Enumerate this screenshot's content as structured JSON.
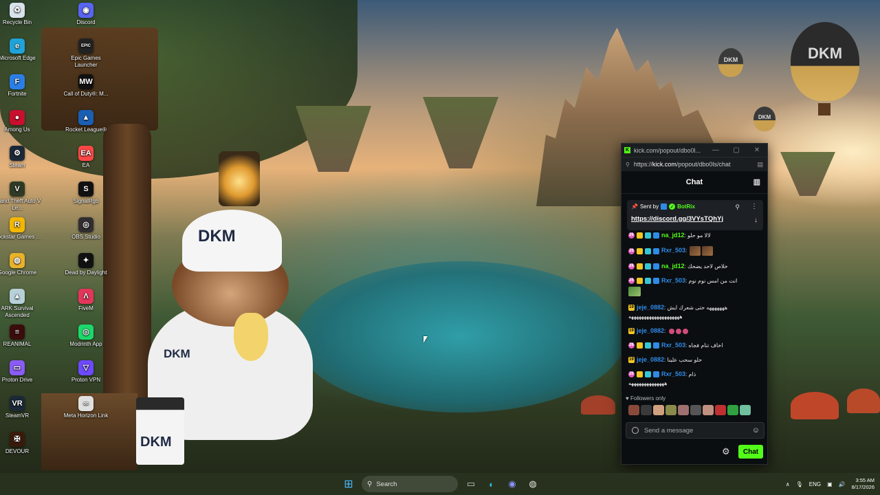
{
  "desktop_icons": [
    {
      "label": "Recycle Bin",
      "icon": "recycle-bin-icon",
      "color": "#d8e2ea",
      "glyph": "♻"
    },
    {
      "label": "Discord",
      "icon": "discord-icon",
      "color": "#5865f2",
      "glyph": "◉"
    },
    {
      "label": "Microsoft Edge",
      "icon": "edge-icon",
      "color": "#1fa3d8",
      "glyph": "e"
    },
    {
      "label": "Epic Games Launcher",
      "icon": "epic-games-icon",
      "color": "#222222",
      "glyph": "EPIC"
    },
    {
      "label": "Fortnite",
      "icon": "fortnite-icon",
      "color": "#2a7ee6",
      "glyph": "F"
    },
    {
      "label": "Call of Duty®: M...",
      "icon": "call-of-duty-icon",
      "color": "#111111",
      "glyph": "MW"
    },
    {
      "label": "Among Us",
      "icon": "among-us-icon",
      "color": "#c8102e",
      "glyph": "●"
    },
    {
      "label": "Rocket League®",
      "icon": "rocket-league-icon",
      "color": "#1a5fb4",
      "glyph": "▲"
    },
    {
      "label": "Steam",
      "icon": "steam-icon",
      "color": "#1b2838",
      "glyph": "⚙"
    },
    {
      "label": "EA",
      "icon": "ea-icon",
      "color": "#ff4747",
      "glyph": "EA"
    },
    {
      "label": "Grand Theft Auto V Le...",
      "icon": "gta-icon",
      "color": "#2e3a24",
      "glyph": "V"
    },
    {
      "label": "SignalRgb",
      "icon": "signalrgb-icon",
      "color": "#111111",
      "glyph": "S"
    },
    {
      "label": "Rockstar Games ...",
      "icon": "rockstar-icon",
      "color": "#f2b800",
      "glyph": "R"
    },
    {
      "label": "OBS Studio",
      "icon": "obs-icon",
      "color": "#302e31",
      "glyph": "◎"
    },
    {
      "label": "Google Chrome",
      "icon": "chrome-icon",
      "color": "#e8b22a",
      "glyph": "◍"
    },
    {
      "label": "Dead by Daylight",
      "icon": "dead-by-daylight-icon",
      "color": "#111111",
      "glyph": "✦"
    },
    {
      "label": "ARK Survival Ascended",
      "icon": "ark-icon",
      "color": "#b8d0d8",
      "glyph": "▲"
    },
    {
      "label": "FiveM",
      "icon": "fivem-icon",
      "color": "#e2365b",
      "glyph": "Λ"
    },
    {
      "label": "REANIMAL",
      "icon": "reanimal-icon",
      "color": "#3a0c0c",
      "glyph": "≡"
    },
    {
      "label": "Modrinth App",
      "icon": "modrinth-icon",
      "color": "#1bd96a",
      "glyph": "◎"
    },
    {
      "label": "Proton Drive",
      "icon": "proton-drive-icon",
      "color": "#8a5cf5",
      "glyph": "▭"
    },
    {
      "label": "Proton VPN",
      "icon": "proton-vpn-icon",
      "color": "#6d4aff",
      "glyph": "▽"
    },
    {
      "label": "SteamVR",
      "icon": "steamvr-icon",
      "color": "#1b2838",
      "glyph": "VR"
    },
    {
      "label": "Meta Horizon Link",
      "icon": "meta-horizon-icon",
      "color": "#e0e0e0",
      "glyph": "∞"
    },
    {
      "label": "DEVOUR",
      "icon": "devour-icon",
      "color": "#3a1a0a",
      "glyph": "✠"
    }
  ],
  "wallpaper": {
    "balloon_big": "DKM",
    "balloon_small_1": "DKM",
    "balloon_small_2": "DKM",
    "cap": "DKM",
    "shirt": "DKM",
    "cup": "DKM"
  },
  "kick_window": {
    "title": "kick.com/popout/dbo0l...",
    "url_prefix": "https://",
    "url_host": "kick.com",
    "url_path": "/popout/dbo0ls/chat",
    "chat_header": "Chat",
    "pinned": {
      "sent_by_label": "Sent by",
      "sender": "BotRix",
      "link": "https://discord.gg/3VYsTQhYj"
    },
    "messages": [
      {
        "user": "na_jd12",
        "user_color": "#53fc18",
        "text": "لالا مو حلو",
        "badges": [
          "sub",
          "crown",
          "vip",
          "og"
        ]
      },
      {
        "user": "Rxr_503",
        "user_color": "#2e8be8",
        "text": "",
        "badges": [
          "sub",
          "crown",
          "vip",
          "og"
        ],
        "emotes": 2
      },
      {
        "user": "na_jd12",
        "user_color": "#53fc18",
        "text": "خلاص لاحد يضحك",
        "badges": [
          "sub",
          "crown",
          "vip",
          "og"
        ]
      },
      {
        "user": "Rxr_503",
        "user_color": "#2e8be8",
        "text": "انت من امس نوم نوم",
        "badges": [
          "sub",
          "crown",
          "vip",
          "og"
        ]
      },
      {
        "user": "jeje_0882",
        "user_color": "#2e8be8",
        "text": "هههههههه حتى شعرك ايش",
        "badges": [
          "19"
        ]
      },
      {
        "user": "jeje_0882",
        "user_color": "#2e8be8",
        "text": "",
        "badges": [
          "19"
        ],
        "dots": 3
      },
      {
        "user": "Rxr_503",
        "user_color": "#2e8be8",
        "text": "اخاف تنام فجاه",
        "badges": [
          "sub",
          "crown",
          "vip",
          "og"
        ]
      },
      {
        "user": "jeje_0882",
        "user_color": "#2e8be8",
        "text": "حلو سحب علينا",
        "badges": [
          "19"
        ]
      },
      {
        "user": "Rxr_503",
        "user_color": "#2e8be8",
        "text": "ذام",
        "badges": [
          "sub",
          "crown",
          "vip",
          "og"
        ]
      }
    ],
    "overflow_line_1": "ههههههههههههههههههههه",
    "overflow_line_2": "ههههههههههههههه",
    "followers_only": "Followers only",
    "send_placeholder": "Send a message",
    "chat_button": "Chat"
  },
  "taskbar": {
    "search_placeholder": "Search",
    "language": "ENG",
    "time": "3:55 AM",
    "date": "8/17/2026"
  }
}
